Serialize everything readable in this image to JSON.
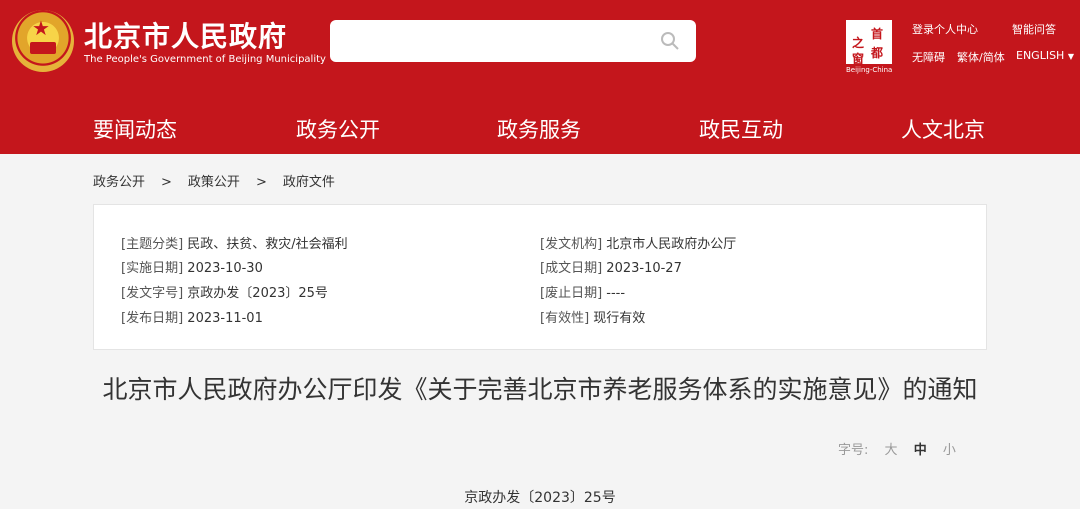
{
  "header": {
    "title": "北京市人民政府",
    "subtitle": "The People's Government of Beijing Municipality",
    "capital_logo": {
      "chars": [
        "首",
        "之",
        "都",
        "窗"
      ],
      "caption": "Beijing-China"
    },
    "links": {
      "login": "登录个人中心",
      "qa": "智能问答",
      "accessibility": "无障碍",
      "traditional": "繁体/简体",
      "english": "ENGLISH"
    },
    "search": {
      "placeholder": ""
    },
    "brand_color": "#c4161c"
  },
  "nav": [
    "要闻动态",
    "政务公开",
    "政务服务",
    "政民互动",
    "人文北京"
  ],
  "breadcrumb": [
    "政务公开",
    "政策公开",
    "政府文件"
  ],
  "breadcrumb_sep": ">",
  "meta": {
    "left": [
      [
        "[主题分类]",
        "民政、扶贫、救灾/社会福利"
      ],
      [
        "[实施日期]",
        "2023-10-30"
      ],
      [
        "[发文字号]",
        "京政办发〔2023〕25号"
      ],
      [
        "[发布日期]",
        "2023-11-01"
      ]
    ],
    "right": [
      [
        "[发文机构]",
        "北京市人民政府办公厅"
      ],
      [
        "[成文日期]",
        "2023-10-27"
      ],
      [
        "[废止日期]",
        "----"
      ],
      [
        "[有效性]",
        "现行有效"
      ]
    ]
  },
  "doc": {
    "title": "北京市人民政府办公厅印发《关于完善北京市养老服务体系的实施意见》的通知",
    "font_label": "字号:",
    "font_sizes": [
      "大",
      "中",
      "小"
    ],
    "number": "京政办发〔2023〕25号"
  }
}
